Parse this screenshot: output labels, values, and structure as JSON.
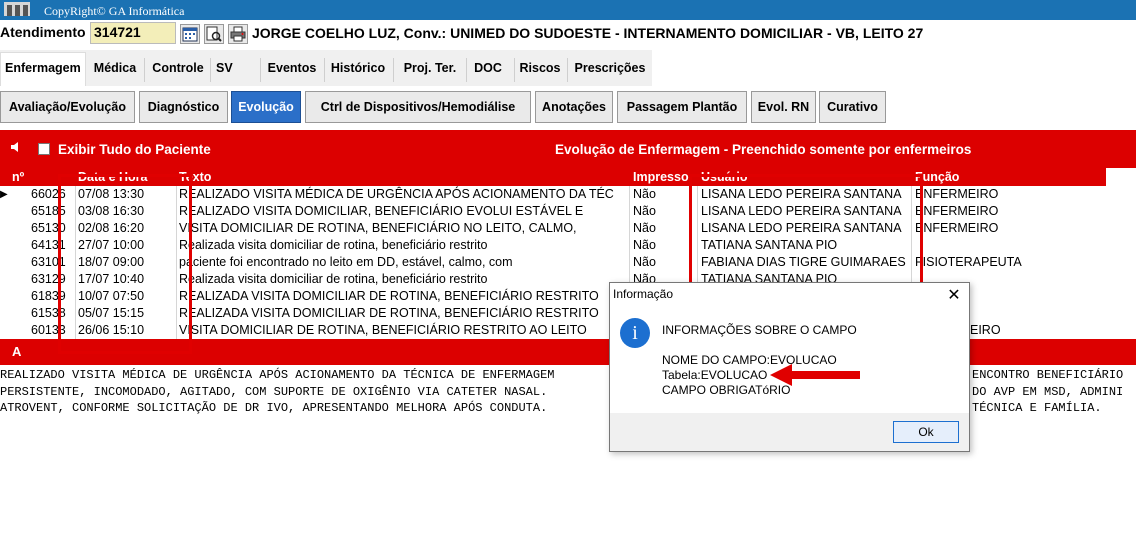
{
  "header": {
    "copyright": "CopyRight© GA Informática"
  },
  "atendimento": {
    "label": "Atendimento",
    "value": "314721",
    "patient_line": "JORGE COELHO LUZ, Conv.: UNIMED DO SUDOESTE - INTERNAMENTO DOMICILIAR - VB, LEITO 27",
    "icons": [
      "calendar-icon",
      "search-icon",
      "printer-icon"
    ]
  },
  "main_tabs": [
    "Enfermagem",
    "Médica",
    "Controle",
    "SV",
    "Eventos",
    "Histórico",
    "Proj. Ter.",
    "DOC",
    "Riscos",
    "Prescrições"
  ],
  "sub_tabs": [
    "Avaliação/Evolução",
    "Diagnóstico",
    "Evolução",
    "Ctrl de Dispositivos/Hemodiálise",
    "Anotações",
    "Passagem Plantão",
    "Evol. RN",
    "Curativo"
  ],
  "filter": {
    "show_all_label": "Exibir Tudo do Paciente",
    "banner": "Evolução de Enfermagem - Preenchido somente por enfermeiros"
  },
  "grid": {
    "columns": [
      "nº",
      "Data e Hora",
      "Texto",
      "Impresso",
      "Usuário",
      "Função"
    ],
    "rows": [
      {
        "n": "66026",
        "dt": "07/08 13:30",
        "texto": "REALIZADO VISITA MÉDICA DE URGÊNCIA APÓS ACIONAMENTO DA TÉC",
        "impresso": "Não",
        "usuario": "LISANA LEDO PEREIRA SANTANA",
        "funcao": "ENFERMEIRO"
      },
      {
        "n": "65185",
        "dt": "03/08 16:30",
        "texto": "REALIZADO VISITA DOMICILIAR, BENEFICIÁRIO EVOLUI ESTÁVEL E",
        "impresso": "Não",
        "usuario": "LISANA LEDO PEREIRA SANTANA",
        "funcao": "ENFERMEIRO"
      },
      {
        "n": "65130",
        "dt": "02/08 16:20",
        "texto": "VISITA DOMICILIAR DE ROTINA, BENEFICIÁRIO NO LEITO, CALMO,",
        "impresso": "Não",
        "usuario": "LISANA LEDO PEREIRA SANTANA",
        "funcao": "ENFERMEIRO"
      },
      {
        "n": "64131",
        "dt": "27/07 10:00",
        "texto": "Realizada visita domiciliar de rotina, beneficiário restrito",
        "impresso": "Não",
        "usuario": "TATIANA SANTANA PIO",
        "funcao": ""
      },
      {
        "n": "63101",
        "dt": "18/07 09:00",
        "texto": "paciente foi encontrado no leito em DD, estável, calmo, com",
        "impresso": "Não",
        "usuario": "FABIANA DIAS TIGRE GUIMARAES",
        "funcao": "FISIOTERAPEUTA"
      },
      {
        "n": "63129",
        "dt": "17/07 10:40",
        "texto": "Realizada visita domiciliar de rotina, beneficiário restrito",
        "impresso": "Não",
        "usuario": "TATIANA SANTANA PIO",
        "funcao": ""
      },
      {
        "n": "61839",
        "dt": "10/07 07:50",
        "texto": "REALIZADA VISITA DOMICILIAR DE ROTINA, BENEFICIÁRIO RESTRITO",
        "impresso": "",
        "usuario": "",
        "funcao": ""
      },
      {
        "n": "61538",
        "dt": "05/07 15:15",
        "texto": "REALIZADA VISITA DOMICILIAR DE ROTINA, BENEFICIÁRIO RESTRITO",
        "impresso": "",
        "usuario": "",
        "funcao": ""
      },
      {
        "n": "60133",
        "dt": "26/06 15:10",
        "texto": "VISITA DOMICILIAR DE ROTINA, BENEFICIÁRIO RESTRITO AO LEITO",
        "impresso": "",
        "usuario": "",
        "funcao": "EIRO"
      }
    ]
  },
  "memo": {
    "label": "A",
    "line1_left": "REALIZADO VISITA MÉDICA DE URGÊNCIA APÓS ACIONAMENTO DA TÉCNICA DE ENFERMAGEM",
    "line1_right": "ENCONTRO BENEFICIÁRIO",
    "line2_left": "PERSISTENTE, INCOMODADO, AGITADO, COM SUPORTE DE OXIGÊNIO VIA CATETER NASAL.",
    "line2_right": "DO AVP EM MSD, ADMINI",
    "line3_left": "ATROVENT, CONFORME SOLICITAÇÃO DE DR IVO, APRESENTANDO MELHORA APÓS CONDUTA.",
    "line3_right": "TÉCNICA E FAMÍLIA."
  },
  "dialog": {
    "title": "Informação",
    "heading": "INFORMAÇÕES SOBRE O CAMPO",
    "line1": "NOME DO CAMPO:EVOLUCAO",
    "line2": "Tabela:EVOLUCAO",
    "line3": "CAMPO OBRIGATóRIO",
    "ok": "Ok"
  }
}
